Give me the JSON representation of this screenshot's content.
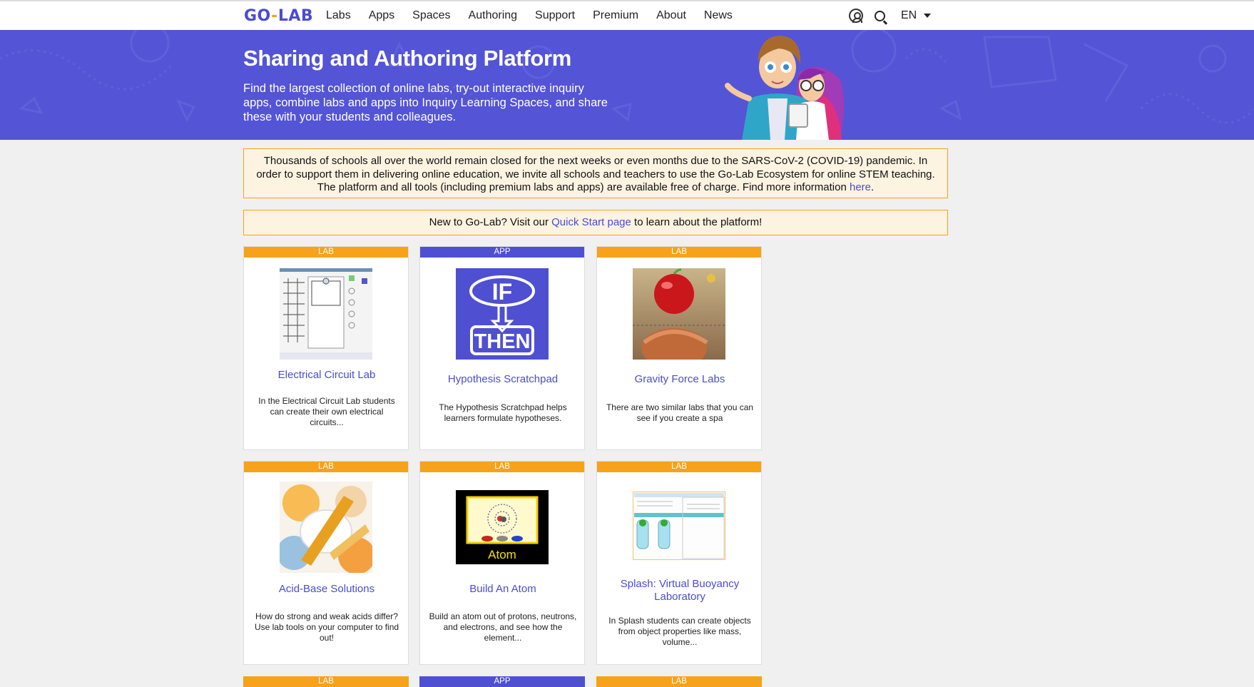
{
  "nav": {
    "logo_main": "GO",
    "logo_dash": "-",
    "logo_end": "LAB",
    "links": [
      "Labs",
      "Apps",
      "Spaces",
      "Authoring",
      "Support",
      "Premium",
      "About",
      "News"
    ],
    "language": "EN",
    "user_icon": "user-icon",
    "search_icon": "search-icon"
  },
  "hero": {
    "title": "Sharing and Authoring Platform",
    "subtitle": "Find the largest collection of online labs, try-out interactive inquiry apps, combine labs and apps into Inquiry Learning Spaces, and share these with your students and colleagues."
  },
  "notice_covid": {
    "text": "Thousands of schools all over the world remain closed for the next weeks or even months due to the SARS-CoV-2 (COVID-19) pandemic. In order to support them in delivering online education, we invite all schools and teachers to use the Go-Lab Ecosystem for online STEM teaching. The platform and all tools (including premium labs and apps) are available free of charge. Find more information ",
    "link": "here",
    "end": "."
  },
  "notice_quickstart": {
    "before": "New to Go-Lab? Visit our ",
    "link": "Quick Start page",
    "after": " to learn about the platform!"
  },
  "cards": [
    {
      "tag": "LAB",
      "title": "Electrical Circuit Lab",
      "desc": "In the Electrical Circuit Lab students can create their own electrical circuits..."
    },
    {
      "tag": "APP",
      "title": "Hypothesis Scratchpad",
      "desc": "The Hypothesis Scratchpad helps learners formulate hypotheses."
    },
    {
      "tag": "LAB",
      "title": "Gravity Force Labs",
      "desc": "There are two similar labs that you can see if you create a spa"
    },
    {
      "tag": "LAB",
      "title": "Acid-Base Solutions",
      "desc": "How do strong and weak acids differ? Use lab tools on your computer to find out!"
    },
    {
      "tag": "LAB",
      "title": "Build An Atom",
      "desc": "Build an atom out of protons, neutrons, and electrons, and see how the element..."
    },
    {
      "tag": "LAB",
      "title": "Splash: Virtual Buoyancy Laboratory",
      "desc": "In Splash students can create objects from object properties like mass, volume..."
    }
  ],
  "thumb_text": {
    "if": "IF",
    "then": "THEN",
    "atom": "Atom"
  },
  "partial_row": [
    "LAB",
    "APP",
    "LAB"
  ],
  "colors": {
    "brand_purple": "#5454d6",
    "lab_orange": "#f7a21b",
    "app_blue": "#4f4fd2",
    "link": "#4b4bd4"
  }
}
